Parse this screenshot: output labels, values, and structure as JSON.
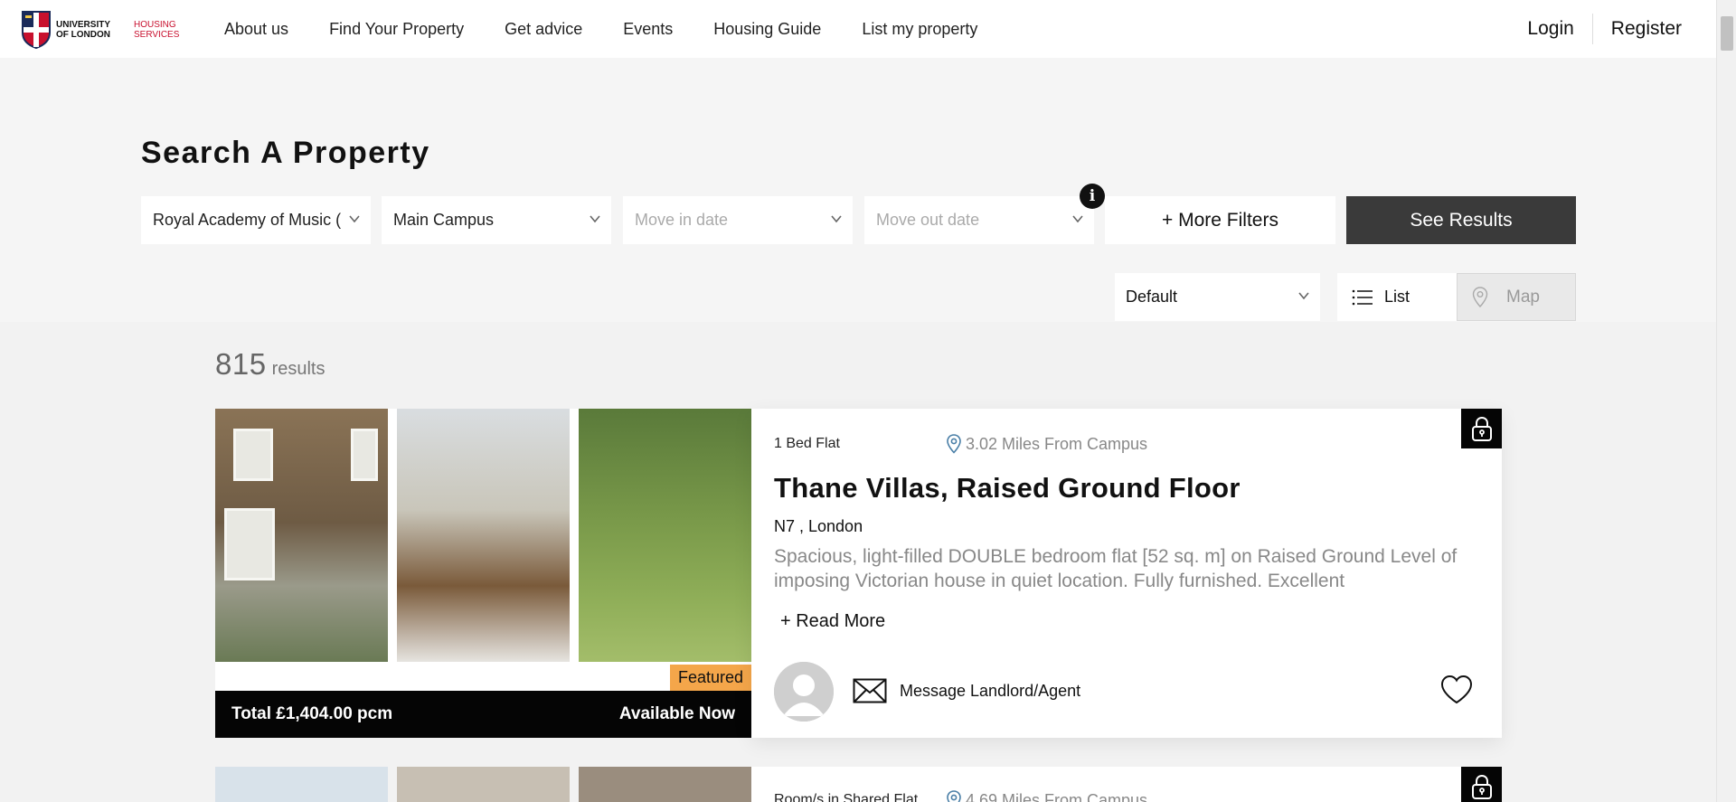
{
  "header": {
    "logo": {
      "org": "UNIVERSITY OF LONDON",
      "service": "HOUSING SERVICES"
    },
    "nav": [
      "About us",
      "Find Your Property",
      "Get advice",
      "Events",
      "Housing Guide",
      "List my property"
    ],
    "login": "Login",
    "register": "Register"
  },
  "search": {
    "title": "Search A Property",
    "institution": "Royal Academy of Music (",
    "campus": "Main Campus",
    "move_in_placeholder": "Move in date",
    "move_out_placeholder": "Move out date",
    "info_icon": "i",
    "more_filters": "+ More Filters",
    "see_results": "See Results",
    "sort": "Default",
    "list_view": "List",
    "map_view": "Map"
  },
  "results": {
    "count": "815",
    "label": "results"
  },
  "listings": [
    {
      "type": "1 Bed Flat",
      "distance": "3.02 Miles From Campus",
      "title": "Thane Villas, Raised Ground Floor",
      "location": "N7 , London",
      "description": "Spacious, light-filled DOUBLE bedroom flat [52 sq. m] on Raised Ground Level of imposing Victorian house in quiet location. Fully furnished. Excellent",
      "read_more": "+ Read More",
      "price": "Total £1,404.00 pcm",
      "availability": "Available Now",
      "badge": "Featured",
      "contact": "Message Landlord/Agent"
    },
    {
      "type": "Room/s in Shared Flat",
      "distance": "4.69 Miles From Campus"
    }
  ],
  "colors": {
    "accent_red": "#c8102e",
    "featured_orange": "#f4a64a",
    "dark_button": "#3a3a3a"
  }
}
